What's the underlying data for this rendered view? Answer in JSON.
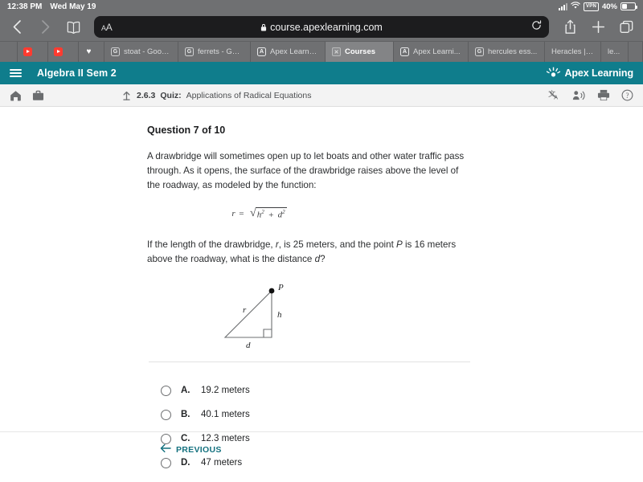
{
  "status_bar": {
    "time": "12:38 PM",
    "date": "Wed May 19",
    "vpn": "VPN",
    "battery_percent": "40%"
  },
  "toolbar": {
    "back_icon": "chevron-left-icon",
    "forward_icon": "chevron-right-icon",
    "bookmarks_icon": "book-icon",
    "aa_label_small": "A",
    "aa_label_large": "A",
    "lock_icon": "lock-icon",
    "url": "course.apexlearning.com",
    "reload_icon": "reload-icon",
    "share_icon": "share-icon",
    "new_tab_icon": "plus-icon",
    "tabs_icon": "tabs-icon"
  },
  "tabs": [
    {
      "title": "",
      "favicon": "youtube-icon",
      "active": false
    },
    {
      "title": "",
      "favicon": "youtube-icon",
      "active": false
    },
    {
      "title": "",
      "favicon": "heart-icon",
      "active": false
    },
    {
      "title": "stoat - Goog...",
      "favicon": "google-icon",
      "active": false
    },
    {
      "title": "ferrets - Goo...",
      "favicon": "apex-icon",
      "active": false
    },
    {
      "title": "Apex Learning",
      "favicon": "apex-icon",
      "active": false
    },
    {
      "title": "Courses",
      "favicon": "close-icon",
      "active": true
    },
    {
      "title": "Apex Learni...",
      "favicon": "apex-icon",
      "active": false
    },
    {
      "title": "hercules ess...",
      "favicon": "google-icon",
      "active": false
    },
    {
      "title": "Heracles | M...",
      "favicon": "none",
      "active": false
    },
    {
      "title": "le...",
      "favicon": "none",
      "active": false
    }
  ],
  "app_header": {
    "menu_icon": "hamburger-menu-icon",
    "course_title": "Algebra II Sem 2",
    "logo_text": "Apex Learning",
    "brand_color": "#0f7d8c"
  },
  "lesson_bar": {
    "home_icon": "home-icon",
    "briefcase_icon": "briefcase-icon",
    "up_icon": "arrow-up-icon",
    "lesson_number": "2.6.3",
    "activity_type": "Quiz:",
    "lesson_title": "Applications of Radical Equations",
    "translate_icon": "translate-icon",
    "read_aloud_icon": "read-aloud-icon",
    "print_icon": "print-icon",
    "help_icon": "help-icon"
  },
  "question": {
    "heading": "Question 7 of 10",
    "paragraph": "A drawbridge will sometimes open up to let boats and other water traffic pass through. As it opens, the surface of the drawbridge raises above the level of the roadway, as modeled by the function:",
    "formula_lhs": "r",
    "formula_equals": "=",
    "formula_radical_sign": "√",
    "formula_h": "h",
    "formula_h_exp": "2",
    "formula_plus": "+",
    "formula_d": "d",
    "formula_d_exp": "2",
    "followup_part1": "If the length of the drawbridge, ",
    "followup_r": "r",
    "followup_part2": ", is 25 meters, and the point ",
    "followup_P": "P",
    "followup_part3": " is 16 meters above the roadway, what is the distance ",
    "followup_d": "d",
    "followup_part4": "?"
  },
  "figure": {
    "label_P": "P",
    "label_r": "r",
    "label_h": "h",
    "label_d": "d",
    "description": "right-triangle-diagram"
  },
  "options": [
    {
      "letter": "A.",
      "text": "19.2 meters",
      "selected": false
    },
    {
      "letter": "B.",
      "text": "40.1 meters",
      "selected": false
    },
    {
      "letter": "C.",
      "text": "12.3 meters",
      "selected": false
    },
    {
      "letter": "D.",
      "text": "47 meters",
      "selected": false
    }
  ],
  "footer": {
    "previous_label": "PREVIOUS",
    "previous_icon": "arrow-left-icon"
  }
}
